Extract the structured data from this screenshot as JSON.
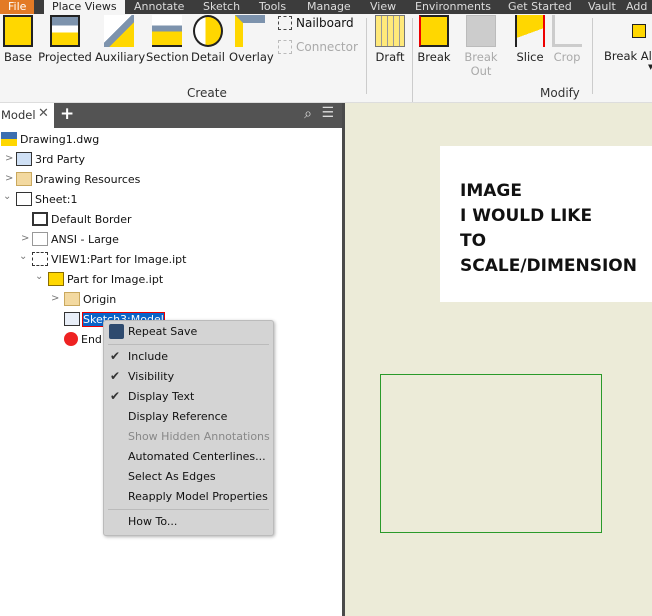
{
  "tabs": [
    "File",
    "Place Views",
    "Annotate",
    "Sketch",
    "Tools",
    "Manage",
    "View",
    "Environments",
    "Get Started",
    "Vault",
    "Add"
  ],
  "ribbon": {
    "create": {
      "label": "Create",
      "buttons": [
        "Base",
        "Projected",
        "Auxiliary",
        "Section",
        "Detail",
        "Overlay"
      ],
      "small": [
        "Nailboard",
        "Connector"
      ]
    },
    "draft": "Draft",
    "modify": {
      "label": "Modify",
      "buttons": [
        "Break",
        "Break Out",
        "Slice",
        "Crop"
      ]
    },
    "break_align": "Break Ali"
  },
  "browser": {
    "tab": "Model",
    "tree": [
      "Drawing1.dwg",
      "3rd Party",
      "Drawing Resources",
      "Sheet:1",
      "Default Border",
      "ANSI - Large",
      "VIEW1:Part for Image.ipt",
      "Part for Image.ipt",
      "Origin",
      "Sketch3:Model",
      "End of Part"
    ]
  },
  "sheet_text": [
    "IMAGE",
    "I WOULD LIKE",
    "TO",
    "SCALE/DIMENSION"
  ],
  "menu": {
    "items": [
      "Repeat Save",
      "Include",
      "Visibility",
      "Display Text",
      "Display Reference",
      "Show Hidden Annotations",
      "Automated Centerlines...",
      "Select As Edges",
      "Reapply Model Properties",
      "How To..."
    ]
  },
  "colors": {
    "accent": "#e37a25",
    "selection": "#0a64c8",
    "canvas": "#ecebd8",
    "icon_yellow": "#ffd700"
  }
}
